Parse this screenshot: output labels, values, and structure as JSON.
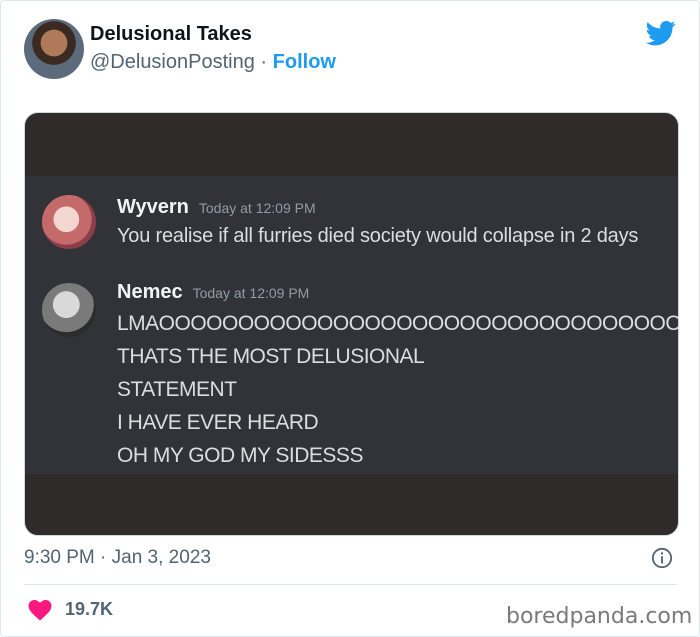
{
  "tweet": {
    "author_name": "Delusional Takes",
    "handle": "@DelusionPosting",
    "separator": "·",
    "follow_label": "Follow",
    "timestamp": "9:30 PM · Jan 3, 2023",
    "likes": "19.7K"
  },
  "screenshot": {
    "messages": [
      {
        "author": "Wyvern",
        "time": "Today at 12:09 PM",
        "lines": [
          "You realise if all furries died society would collapse in 2 days"
        ]
      },
      {
        "author": "Nemec",
        "time": "Today at 12:09 PM",
        "lines": [
          "LMAOOOOOOOOOOOOOOOOOOOOOOOOOOOOOOOOOOOOO",
          "THATS THE MOST DELUSIONAL",
          "STATEMENT",
          "I HAVE EVER HEARD",
          "OH MY GOD MY SIDESSS"
        ]
      }
    ]
  },
  "watermark": "boredpanda.com",
  "icons": {
    "brand": "twitter-bird-icon",
    "info": "info-icon",
    "like": "heart-icon"
  },
  "colors": {
    "accent": "#1d9bf0",
    "heart": "#f91880",
    "discord_bg": "#313338"
  }
}
